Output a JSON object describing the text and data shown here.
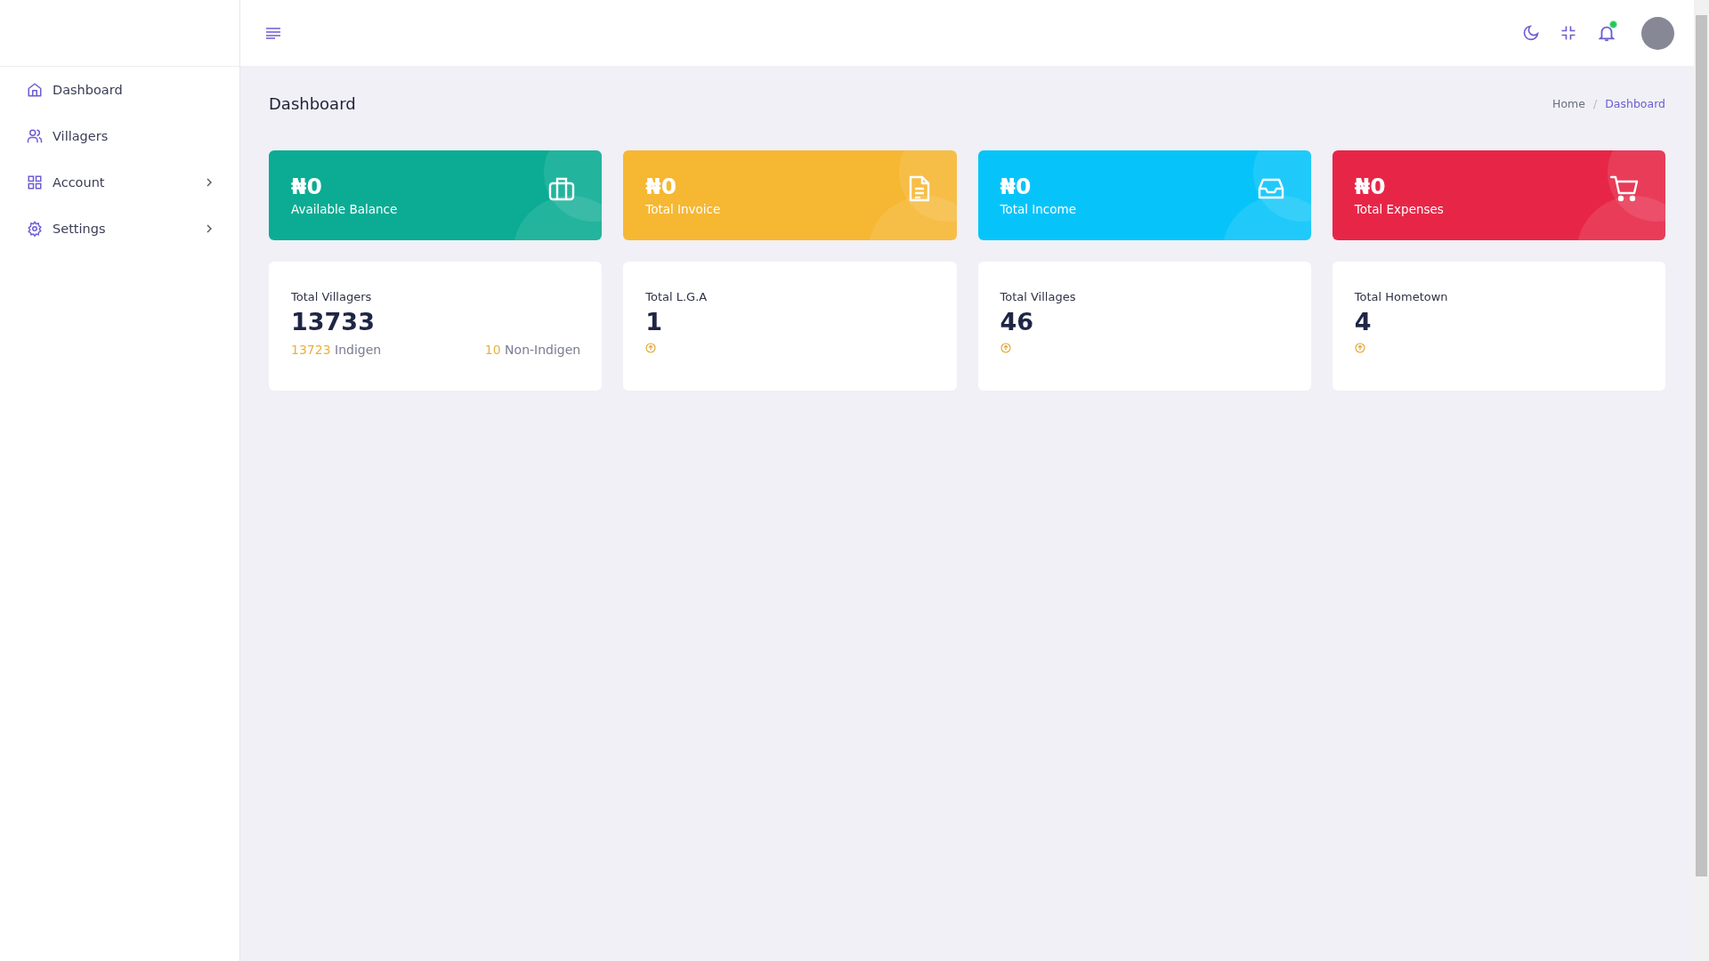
{
  "sidebar": {
    "items": [
      {
        "label": "Dashboard",
        "kind": "home",
        "expandable": false
      },
      {
        "label": "Villagers",
        "kind": "users",
        "expandable": false
      },
      {
        "label": "Account",
        "kind": "grid",
        "expandable": true
      },
      {
        "label": "Settings",
        "kind": "gear",
        "expandable": true
      }
    ]
  },
  "header": {
    "notification_dot": true
  },
  "page": {
    "title": "Dashboard",
    "breadcrumb_separator": "/",
    "breadcrumb": [
      {
        "label": "Home",
        "selected": false
      },
      {
        "label": "Dashboard",
        "selected": true
      }
    ]
  },
  "summary_cards": [
    {
      "amount": "₦0",
      "label": "Available Balance",
      "kind": "briefcase",
      "color": "#0bac93"
    },
    {
      "amount": "₦0",
      "label": "Total Invoice",
      "kind": "file",
      "color": "#f6b733"
    },
    {
      "amount": "₦0",
      "label": "Total Income",
      "kind": "inbox",
      "color": "#06c4fa"
    },
    {
      "amount": "₦0",
      "label": "Total Expenses",
      "kind": "cart",
      "color": "#e72647"
    }
  ],
  "stat_cards": [
    {
      "kind": "breakdown",
      "title": "Total Villagers",
      "value": "13733",
      "left_count": "13723",
      "left_label": "Indigen",
      "right_count": "10",
      "right_label": "Non-Indigen"
    },
    {
      "kind": "trend",
      "title": "Total L.G.A",
      "value": "1"
    },
    {
      "kind": "trend",
      "title": "Total Villages",
      "value": "46"
    },
    {
      "kind": "trend",
      "title": "Total Hometown",
      "value": "4"
    }
  ]
}
